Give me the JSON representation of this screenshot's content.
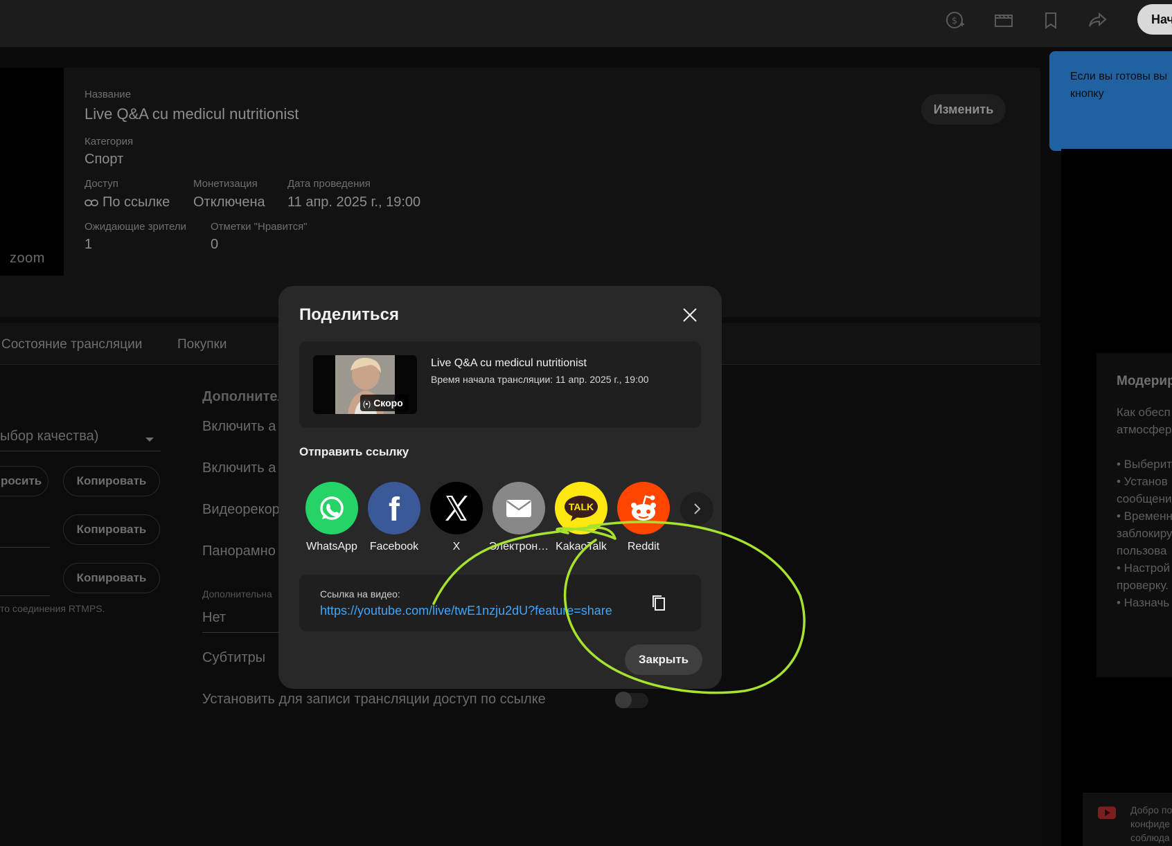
{
  "topbar": {
    "icons": [
      "monetization-icon",
      "clapperboard-icon",
      "bookmark-icon",
      "share-arrow-icon"
    ],
    "start_button": "Нач"
  },
  "stream_info": {
    "title_label": "Название",
    "title": "Live Q&A cu medicul nutritionist",
    "category_label": "Категория",
    "category": "Спорт",
    "access_label": "Доступ",
    "access": "По ссылке",
    "monetization_label": "Монетизация",
    "monetization": "Отключена",
    "date_label": "Дата проведения",
    "date": "11 апр. 2025 г., 19:00",
    "waiting_label": "Ожидающие зрители",
    "waiting": "1",
    "likes_label": "Отметки \"Нравится\"",
    "likes": "0",
    "edit_button": "Изменить",
    "preview_logo": "zoom"
  },
  "tooltip": {
    "line1": "Если вы готовы вы",
    "line2": "кнопку"
  },
  "tabs": [
    "Состояние трансляции",
    "Покупки"
  ],
  "settings": {
    "quality_select": "ыбор качества)",
    "reset_button": "росить",
    "copy_button": "Копировать",
    "rtmps_note": "то соединения RTMPS.",
    "section_heading": "Дополнител",
    "enable_1": "Включить а",
    "enable_2": "Включить а",
    "video_rec": "Видеорекор",
    "panorama": "Панорамно",
    "additional_small": "Дополнительна",
    "additional_value": "Нет",
    "subtitles": "Субтитры",
    "link_access": "Установить для записи трансляции доступ по ссылке"
  },
  "moderation": {
    "title": "Модерир",
    "lines": [
      "Как обесп",
      "атмосфер",
      "",
      "• Выберит",
      "• Установ",
      "сообщени",
      "• Временн",
      "заблокиру",
      "пользова",
      "• Настрой",
      "проверку.",
      "• Назначь"
    ]
  },
  "bottom_right": {
    "lines": [
      "Добро по",
      "конфиде",
      "соблюда"
    ]
  },
  "dialog": {
    "title": "Поделиться",
    "video_title": "Live Q&A cu medicul nutritionist",
    "video_subtitle": "Время начала трансляции: 11 апр. 2025 г., 19:00",
    "thumb_badge": "Скоро",
    "send_link_label": "Отправить ссылку",
    "share_targets": [
      {
        "label": "WhatsApp",
        "icon": "whatsapp-icon",
        "color": "#25d366"
      },
      {
        "label": "Facebook",
        "icon": "facebook-icon",
        "color": "#3b5998"
      },
      {
        "label": "X",
        "icon": "x-icon",
        "color": "#000000"
      },
      {
        "label": "Электрон…",
        "icon": "email-icon",
        "color": "#888888"
      },
      {
        "label": "KakaoTalk",
        "icon": "kakaotalk-icon",
        "color": "#ffe812"
      },
      {
        "label": "Reddit",
        "icon": "reddit-icon",
        "color": "#ff4500"
      }
    ],
    "link_label": "Ссылка на видео:",
    "link_url": "https://youtube.com/live/twE1nzju2dU?feature=share",
    "close_button": "Закрыть"
  },
  "annotation": {
    "color": "#a6e22e"
  }
}
